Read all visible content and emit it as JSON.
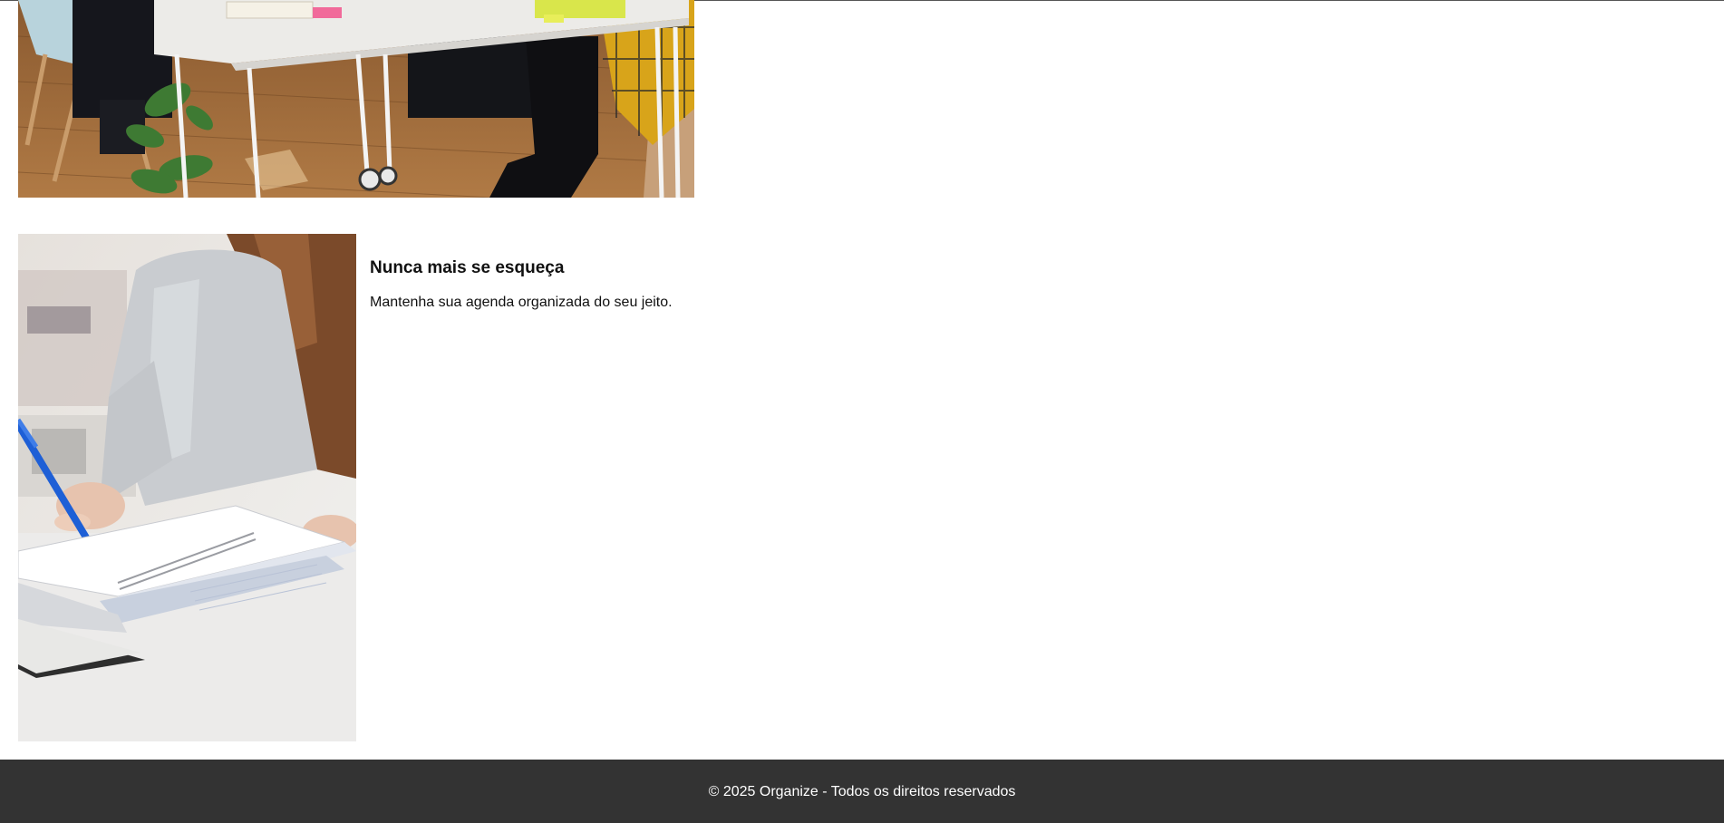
{
  "top_image": {
    "alt": "people-meeting-at-table-photo"
  },
  "feature": {
    "image_alt": "woman-writing-in-notebook-photo",
    "title": "Nunca mais se esqueça",
    "description": "Mantenha sua agenda organizada do seu jeito."
  },
  "footer": {
    "text": "© 2025 Organize - Todos os direitos reservados"
  },
  "colors": {
    "footer_background": "#333333",
    "footer_text": "#ffffff",
    "page_background": "#ffffff",
    "text": "#111111"
  }
}
